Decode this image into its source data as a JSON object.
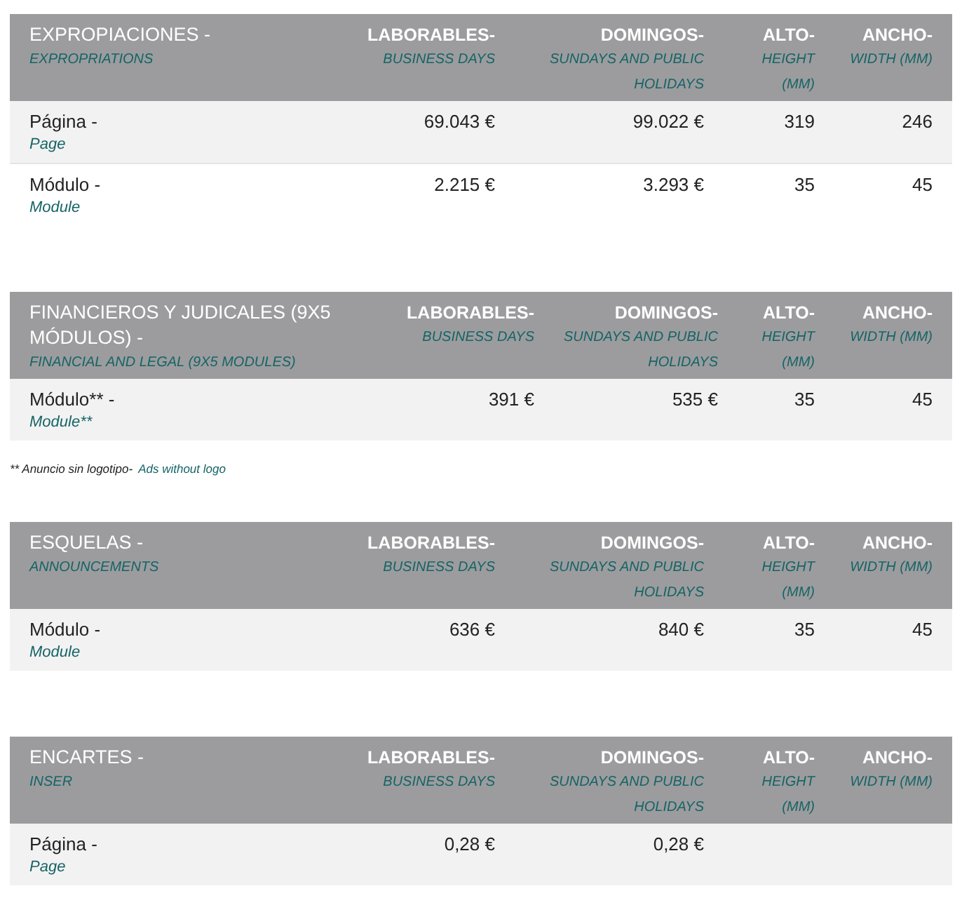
{
  "sections": [
    {
      "title": "EXPROPIACIONES -",
      "subtitle": "EXPROPRIATIONS",
      "columns": [
        {
          "label": "LABORABLES-",
          "sublabel": "BUSINESS DAYS"
        },
        {
          "label": "DOMINGOS-",
          "sublabel": "SUNDAYS AND PUBLIC HOLIDAYS"
        },
        {
          "label": "ALTO-",
          "sublabel": "HEIGHT (MM)"
        },
        {
          "label": "ANCHO-",
          "sublabel": "WIDTH (MM)"
        }
      ],
      "rows": [
        {
          "label": "Página -",
          "sublabel": "Page",
          "cells": [
            "69.043 €",
            "99.022 €",
            "319",
            "246"
          ]
        },
        {
          "label": "Módulo -",
          "sublabel": "Module",
          "cells": [
            "2.215 €",
            "3.293 €",
            "35",
            "45"
          ]
        }
      ]
    },
    {
      "title": "FINANCIEROS Y JUDICALES (9X5 MÓDULOS) -",
      "subtitle": "FINANCIAL AND LEGAL (9X5 MODULES)",
      "columns": [
        {
          "label": "LABORABLES-",
          "sublabel": "BUSINESS DAYS"
        },
        {
          "label": "DOMINGOS-",
          "sublabel": "SUNDAYS AND PUBLIC HOLIDAYS"
        },
        {
          "label": "ALTO-",
          "sublabel": "HEIGHT (MM)"
        },
        {
          "label": "ANCHO-",
          "sublabel": "WIDTH (MM)"
        }
      ],
      "rows": [
        {
          "label": "Módulo** -",
          "sublabel": "Module**",
          "cells": [
            "391 €",
            "535 €",
            "35",
            "45"
          ]
        }
      ],
      "footnote": {
        "text": "** Anuncio sin logotipo-",
        "translation": "Ads without logo"
      }
    },
    {
      "title": "ESQUELAS -",
      "subtitle": "ANNOUNCEMENTS",
      "columns": [
        {
          "label": "LABORABLES-",
          "sublabel": "BUSINESS DAYS"
        },
        {
          "label": "DOMINGOS-",
          "sublabel": "SUNDAYS AND PUBLIC HOLIDAYS"
        },
        {
          "label": "ALTO-",
          "sublabel": "HEIGHT (MM)"
        },
        {
          "label": "ANCHO-",
          "sublabel": "WIDTH (MM)"
        }
      ],
      "rows": [
        {
          "label": "Módulo -",
          "sublabel": "Module",
          "cells": [
            "636 €",
            "840 €",
            "35",
            "45"
          ]
        }
      ]
    },
    {
      "title": "ENCARTES -",
      "subtitle": "INSER",
      "columns": [
        {
          "label": "LABORABLES-",
          "sublabel": "BUSINESS DAYS"
        },
        {
          "label": "DOMINGOS-",
          "sublabel": "SUNDAYS AND PUBLIC HOLIDAYS"
        },
        {
          "label": "ALTO-",
          "sublabel": "HEIGHT (MM)"
        },
        {
          "label": "ANCHO-",
          "sublabel": "WIDTH (MM)"
        }
      ],
      "rows": [
        {
          "label": "Página -",
          "sublabel": "Page",
          "cells": [
            "0,28 €",
            "0,28 €"
          ]
        }
      ]
    }
  ]
}
